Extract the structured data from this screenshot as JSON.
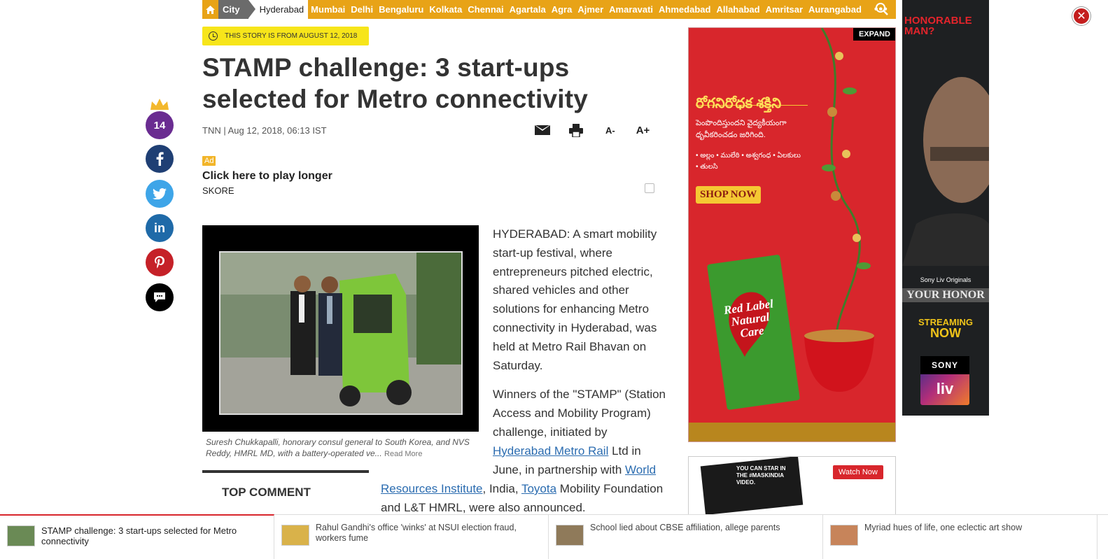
{
  "nav": {
    "section": "City",
    "current": "Hyderabad",
    "cities": [
      "Mumbai",
      "Delhi",
      "Bengaluru",
      "Kolkata",
      "Chennai",
      "Agartala",
      "Agra",
      "Ajmer",
      "Amaravati",
      "Ahmedabad",
      "Allahabad",
      "Amritsar",
      "Aurangabad"
    ],
    "more": "•••"
  },
  "colors": {
    "nav_bg": "#e8a317",
    "badge_bg": "#f7e51a",
    "link": "#2b6cb0",
    "accent_red": "#d8262c"
  },
  "story_badge": "THIS STORY IS FROM AUGUST 12, 2018",
  "headline": "STAMP challenge: 3 start-ups selected for Metro connectivity",
  "byline": "TNN | Aug 12, 2018, 06:13 IST",
  "tools": {
    "font_decrease": "A-",
    "font_increase": "A+"
  },
  "social": {
    "comment_count": "14"
  },
  "sponsored": {
    "tag": "Ad",
    "title": "Click here to play longer",
    "source": "SKORE"
  },
  "image": {
    "caption": "Suresh Chukkapalli, honorary consul general to South Korea, and NVS Reddy, HMRL MD, with a battery-operated ve...",
    "read_more": "Read More"
  },
  "article": {
    "p1": "HYDERABAD: A smart mobility start-up festival, where entrepreneurs pitched electric, shared vehicles and other solutions for enhancing Metro connectivity in Hyderabad, was held at Metro Rail Bhavan on Saturday.",
    "p2_a": "Winners of the \"STAMP\" (Station Access and Mobility Program) challenge, initiated by ",
    "p2_link1": "Hyderabad Metro Rail",
    "p2_b": " Ltd in June, in partnership with ",
    "p2_link2": "World",
    "p2_link2b": "Resources Institute",
    "p2_c": ", India, ",
    "p2_link3": "Toyota",
    "p2_d": " Mobility Foundation and L&T HMRL, were also announced."
  },
  "top_comment_label": "TOP COMMENT",
  "ad_right": {
    "expand": "EXPAND",
    "telugu_title": "రోగనిరోధక శక్తిని",
    "telugu_line": "పెంపొందిస్తుందని వైద్యకీయంగా ధృవీకరించడం జరిగింది.",
    "ingredients": "• అల్లం • ములేఠి • అశ్వగంధ • ఏలకులు • తులసి",
    "cta": "SHOP NOW",
    "brand": "Red Label Natural Care"
  },
  "ad_bottom": {
    "film_text": "YOU CAN STAR IN THE #MASKINDIA VIDEO.",
    "cta": "Watch Now"
  },
  "ad_side": {
    "headline": "HONORABLE MAN?",
    "tagline": "Sony Liv Originals",
    "show": "YOUR HONOR",
    "streaming": "STREAMING",
    "now": "NOW",
    "brand_top": "SONY",
    "brand_bottom": "liv"
  },
  "bottom_strip": [
    {
      "title": "STAMP challenge: 3 start-ups selected for Metro connectivity"
    },
    {
      "title": "Rahul Gandhi's office 'winks' at NSUI election fraud, workers fume"
    },
    {
      "title": "School lied about CBSE affiliation, allege parents"
    },
    {
      "title": "Myriad hues of life, one eclectic art show"
    }
  ]
}
